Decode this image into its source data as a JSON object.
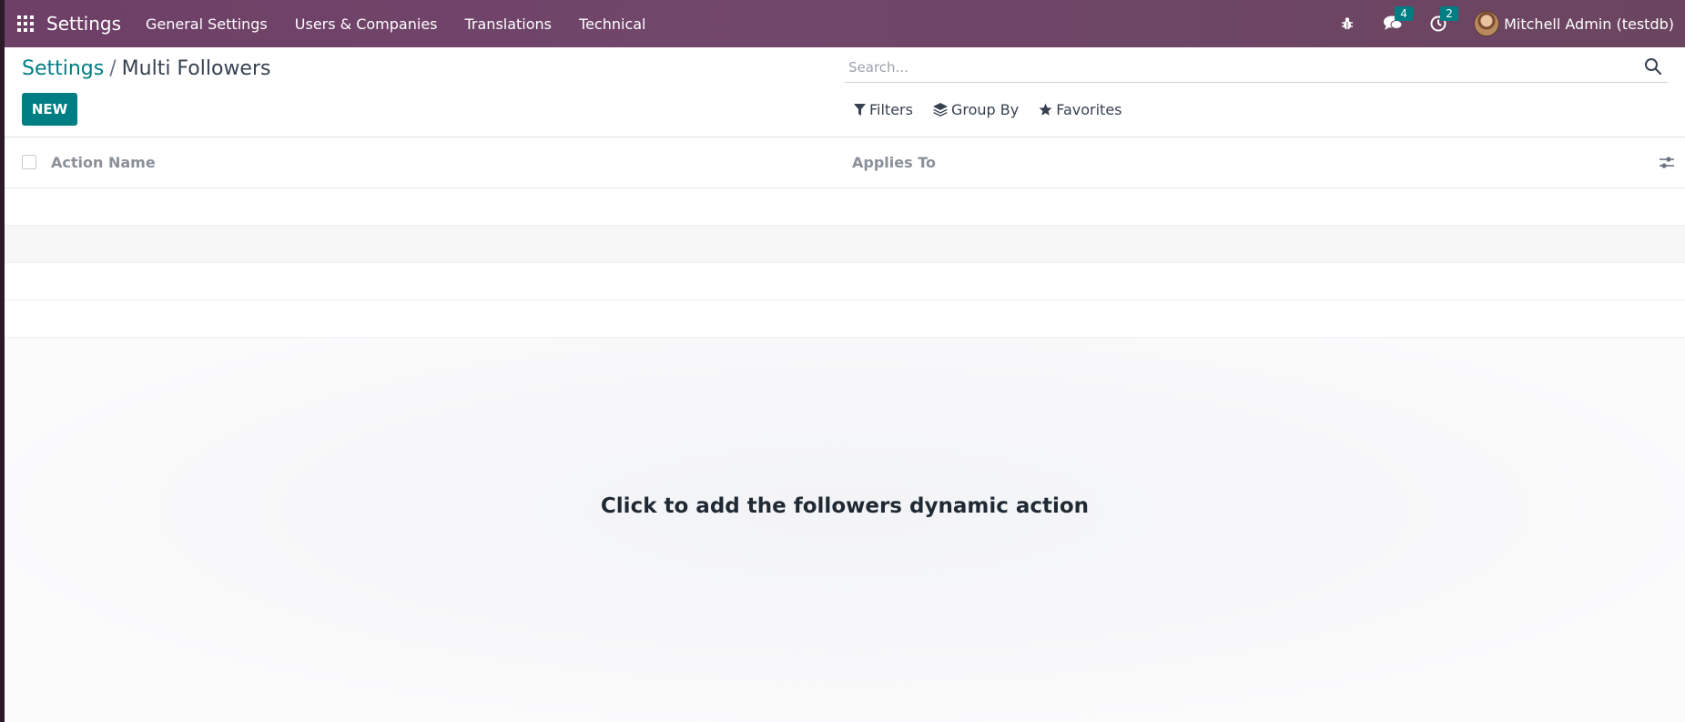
{
  "navbar": {
    "app_title": "Settings",
    "menu": [
      {
        "label": "General Settings"
      },
      {
        "label": "Users & Companies"
      },
      {
        "label": "Translations"
      },
      {
        "label": "Technical"
      }
    ],
    "messages_badge": "4",
    "activities_badge": "2",
    "user_name": "Mitchell Admin (testdb)",
    "icons": [
      "apps-grid-icon",
      "bug-icon",
      "chat-icon",
      "clock-icon",
      "avatar"
    ]
  },
  "breadcrumb": {
    "parent": "Settings",
    "separator": "/",
    "current": "Multi Followers"
  },
  "buttons": {
    "new_label": "NEW"
  },
  "search": {
    "placeholder": "Search...",
    "value": ""
  },
  "filters": {
    "filters_label": "Filters",
    "group_by_label": "Group By",
    "favorites_label": "Favorites"
  },
  "list": {
    "columns": [
      {
        "label": "Action Name"
      },
      {
        "label": "Applies To"
      }
    ],
    "rows": []
  },
  "empty_state": {
    "title": "Click to add the followers dynamic action"
  },
  "colors": {
    "navbar": "#71466b",
    "primary": "#017e84",
    "text": "#374151"
  }
}
